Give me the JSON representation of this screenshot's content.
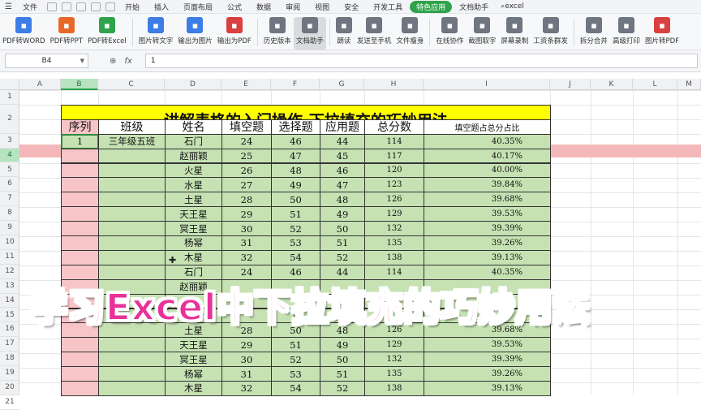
{
  "menubar": {
    "items": [
      "文件",
      "开始",
      "插入",
      "页面布局",
      "公式",
      "数据",
      "审阅",
      "视图",
      "安全",
      "开发工具",
      "特色应用",
      "文档助手"
    ],
    "active": "特色应用",
    "search_text": "excel"
  },
  "ribbon": {
    "buttons": [
      {
        "label": "PDF转WORD",
        "icon": "pdf-to-word-icon",
        "color": "#3d7de6"
      },
      {
        "label": "PDF转PPT",
        "icon": "pdf-to-ppt-icon",
        "color": "#e8682a"
      },
      {
        "label": "PDF转Excel",
        "icon": "pdf-to-excel-icon",
        "color": "#2fa34b"
      },
      {
        "label": "图片转文字",
        "icon": "image-to-text-icon",
        "color": "#3d7de6"
      },
      {
        "label": "输出为图片",
        "icon": "export-image-icon",
        "color": "#3d7de6"
      },
      {
        "label": "输出为PDF",
        "icon": "export-pdf-icon",
        "color": "#d94040"
      },
      {
        "label": "历史版本",
        "icon": "history-icon",
        "color": "#6f7682"
      },
      {
        "label": "文档助手",
        "icon": "doc-assistant-icon",
        "color": "#6f7682"
      },
      {
        "label": "朗读",
        "icon": "read-aloud-icon",
        "color": "#6f7682"
      },
      {
        "label": "发送至手机",
        "icon": "send-phone-icon",
        "color": "#6f7682"
      },
      {
        "label": "文件瘦身",
        "icon": "file-slim-icon",
        "color": "#6f7682"
      },
      {
        "label": "在线协作",
        "icon": "collab-icon",
        "color": "#6f7682"
      },
      {
        "label": "截图取字",
        "icon": "screenshot-text-icon",
        "color": "#6f7682"
      },
      {
        "label": "屏幕录制",
        "icon": "screen-record-icon",
        "color": "#6f7682"
      },
      {
        "label": "工资条群发",
        "icon": "payslip-icon",
        "color": "#6f7682"
      },
      {
        "label": "拆分合并",
        "icon": "split-merge-icon",
        "color": "#6f7682"
      },
      {
        "label": "高级打印",
        "icon": "print-icon",
        "color": "#6f7682"
      },
      {
        "label": "图片转PDF",
        "icon": "image-to-pdf-icon",
        "color": "#d94040"
      }
    ],
    "selected": "文档助手"
  },
  "formula_bar": {
    "name_box": "B4",
    "fx_label": "fx",
    "value": "1"
  },
  "columns": [
    "A",
    "B",
    "C",
    "D",
    "E",
    "F",
    "G",
    "H",
    "I",
    "J",
    "K",
    "L",
    "M"
  ],
  "selected_column": "B",
  "rows": [
    "1",
    "2",
    "3",
    "4",
    "5",
    "6",
    "7",
    "8",
    "9",
    "10",
    "11",
    "12",
    "13",
    "14",
    "15",
    "16",
    "17",
    "18",
    "19",
    "20",
    "21"
  ],
  "selected_row": "4",
  "sheet": {
    "title": "讲解表格的入门操作-下拉填充的巧妙用法",
    "headers": [
      "序列",
      "班级",
      "姓名",
      "填空题",
      "选择题",
      "应用题",
      "总分数",
      "填空题占总分占比"
    ],
    "first_row": {
      "seq": "1",
      "class": "三年级五班"
    },
    "records": [
      {
        "name": "石门",
        "fill": "24",
        "choice": "46",
        "apply": "44",
        "total": "114",
        "pct": "40.35%"
      },
      {
        "name": "赵丽颖",
        "fill": "25",
        "choice": "47",
        "apply": "45",
        "total": "117",
        "pct": "40.17%"
      },
      {
        "name": "火星",
        "fill": "26",
        "choice": "48",
        "apply": "46",
        "total": "120",
        "pct": "40.00%"
      },
      {
        "name": "水星",
        "fill": "27",
        "choice": "49",
        "apply": "47",
        "total": "123",
        "pct": "39.84%"
      },
      {
        "name": "土星",
        "fill": "28",
        "choice": "50",
        "apply": "48",
        "total": "126",
        "pct": "39.68%"
      },
      {
        "name": "天王星",
        "fill": "29",
        "choice": "51",
        "apply": "49",
        "total": "129",
        "pct": "39.53%"
      },
      {
        "name": "冥王星",
        "fill": "30",
        "choice": "52",
        "apply": "50",
        "total": "132",
        "pct": "39.39%"
      },
      {
        "name": "杨幂",
        "fill": "31",
        "choice": "53",
        "apply": "51",
        "total": "135",
        "pct": "39.26%"
      },
      {
        "name": "木星",
        "fill": "32",
        "choice": "54",
        "apply": "52",
        "total": "138",
        "pct": "39.13%"
      },
      {
        "name": "石门",
        "fill": "24",
        "choice": "46",
        "apply": "44",
        "total": "114",
        "pct": "40.35%"
      },
      {
        "name": "赵丽颖",
        "fill": "",
        "choice": "",
        "apply": "",
        "total": "",
        "pct": ""
      },
      {
        "name": "",
        "fill": "",
        "choice": "",
        "apply": "",
        "total": "",
        "pct": ""
      },
      {
        "name": "",
        "fill": "",
        "choice": "9",
        "apply": "",
        "total": "",
        "pct": ""
      },
      {
        "name": "土星",
        "fill": "28",
        "choice": "50",
        "apply": "48",
        "total": "126",
        "pct": "39.68%"
      },
      {
        "name": "天王星",
        "fill": "29",
        "choice": "51",
        "apply": "49",
        "total": "129",
        "pct": "39.53%"
      },
      {
        "name": "冥王星",
        "fill": "30",
        "choice": "52",
        "apply": "50",
        "total": "132",
        "pct": "39.39%"
      },
      {
        "name": "杨幂",
        "fill": "31",
        "choice": "53",
        "apply": "51",
        "total": "135",
        "pct": "39.26%"
      },
      {
        "name": "木星",
        "fill": "32",
        "choice": "54",
        "apply": "52",
        "total": "138",
        "pct": "39.13%"
      }
    ]
  },
  "overlay_caption": "学习Excel中下拉填充的巧妙用法",
  "colors": {
    "title_bg": "#ffff00",
    "data_bg": "#c6e2b3",
    "highlight": "#f4b8bb",
    "caption": "#e8329a",
    "active_tab": "#2fa34b"
  }
}
